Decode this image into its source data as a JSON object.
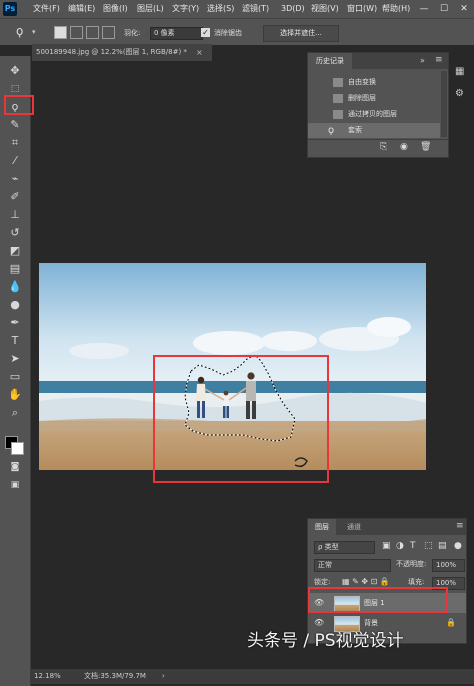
{
  "app": {
    "logo": "Ps"
  },
  "menu": [
    "文件(F)",
    "编辑(E)",
    "图像(I)",
    "图层(L)",
    "文字(Y)",
    "选择(S)",
    "滤镜(T)",
    "3D(D)",
    "视图(V)",
    "窗口(W)",
    "帮助(H)"
  ],
  "window_controls": {
    "minimize": "—",
    "maximize": "☐",
    "close": "✕"
  },
  "options": {
    "feather_label": "羽化:",
    "feather_value": "0 像素",
    "antialias_checked": "✓",
    "antialias_label": "消除锯齿",
    "select_mask_label": "选择并遮住..."
  },
  "document": {
    "tab_title": "500189948.jpg @ 12.2%(图层 1, RGB/8#) *",
    "close": "×"
  },
  "history": {
    "tab": "历史记录",
    "items": [
      "自由变换",
      "删除图层",
      "通过拷贝的图层",
      "套索"
    ]
  },
  "layers": {
    "tabs": [
      "图层",
      "通道"
    ],
    "filter_label": "ρ 类型",
    "blend_mode": "正常",
    "opacity_label": "不透明度:",
    "opacity_value": "100%",
    "lock_label": "锁定:",
    "fill_label": "填充:",
    "fill_value": "100%",
    "items": [
      {
        "name": "图层 1",
        "locked": ""
      },
      {
        "name": "背景",
        "locked": "🔒"
      }
    ]
  },
  "status": {
    "zoom": "12.18%",
    "doc_label": "文档:35.3M/79.7M",
    "arrow": "›"
  },
  "watermark": "头条号 / PS视觉设计",
  "colors": {
    "highlight": "#e8363a",
    "panel": "#535353",
    "canvas": "#282828"
  }
}
